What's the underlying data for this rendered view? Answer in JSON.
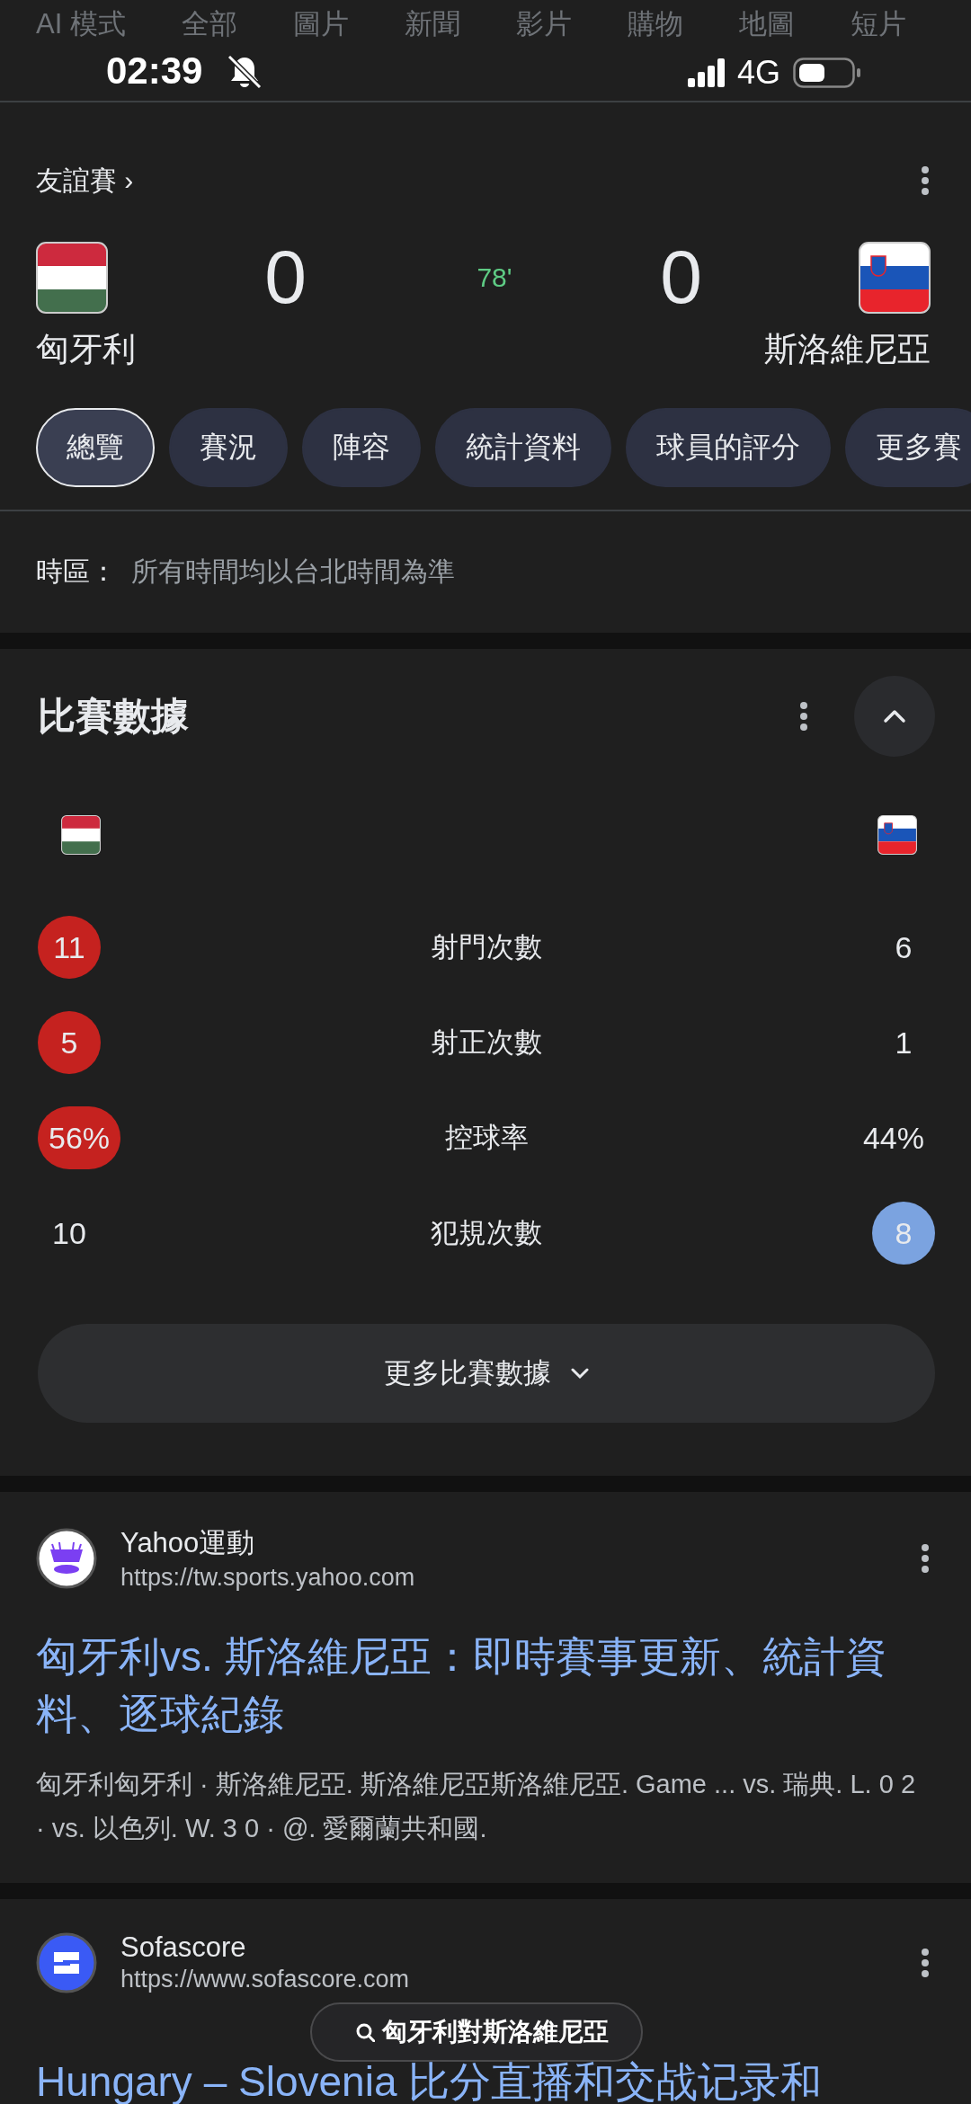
{
  "status_bar": {
    "time": "02:39",
    "network": "4G"
  },
  "search_tabs": [
    {
      "label": "AI 模式",
      "selected": false
    },
    {
      "label": "全部",
      "selected": false
    },
    {
      "label": "圖片",
      "selected": false
    },
    {
      "label": "新聞",
      "selected": false
    },
    {
      "label": "影片",
      "selected": false
    },
    {
      "label": "購物",
      "selected": false
    },
    {
      "label": "地圖",
      "selected": false
    },
    {
      "label": "短片",
      "selected": false
    }
  ],
  "match": {
    "competition": "友誼賽",
    "chevron": "›",
    "minute": "78'",
    "home": {
      "name": "匈牙利",
      "score": "0"
    },
    "away": {
      "name": "斯洛維尼亞",
      "score": "0"
    },
    "tabs": [
      {
        "label": "總覽",
        "selected": true
      },
      {
        "label": "賽況",
        "selected": false
      },
      {
        "label": "陣容",
        "selected": false
      },
      {
        "label": "統計資料",
        "selected": false
      },
      {
        "label": "球員的評分",
        "selected": false
      },
      {
        "label": "更多賽",
        "selected": false
      }
    ],
    "timezone_label": "時區：",
    "timezone_text": "所有時間均以台北時間為準"
  },
  "stats": {
    "title": "比賽數據",
    "rows": [
      {
        "label": "射門次數",
        "home": {
          "value": "11",
          "highlighted": true,
          "color": "#c5221f"
        },
        "away": {
          "value": "6",
          "highlighted": false
        }
      },
      {
        "label": "射正次數",
        "home": {
          "value": "5",
          "highlighted": true,
          "color": "#c5221f"
        },
        "away": {
          "value": "1",
          "highlighted": false
        }
      },
      {
        "label": "控球率",
        "home": {
          "value": "56%",
          "highlighted": true,
          "color": "#c5221f"
        },
        "away": {
          "value": "44%",
          "highlighted": false
        }
      },
      {
        "label": "犯規次數",
        "home": {
          "value": "10",
          "highlighted": false
        },
        "away": {
          "value": "8",
          "highlighted": true,
          "color": "#7ba3e0"
        }
      }
    ],
    "more_button": "更多比賽數據"
  },
  "results": [
    {
      "site": "Yahoo運動",
      "url": "https://tw.sports.yahoo.com",
      "title": "匈牙利vs. 斯洛維尼亞：即時賽事更新、統計資料、逐球紀錄",
      "snippet": "匈牙利匈牙利 · 斯洛維尼亞. 斯洛維尼亞斯洛維尼亞. Game ... vs. 瑞典. L. 0 2 · vs. 以色列. W. 3 0 · @. 愛爾蘭共和國."
    },
    {
      "site": "Sofascore",
      "url": "https://www.sofascore.com",
      "title": "Hungary – Slovenia 比分直播和交战记录和"
    }
  ],
  "search_pill": {
    "query": "匈牙利對斯洛維尼亞"
  }
}
